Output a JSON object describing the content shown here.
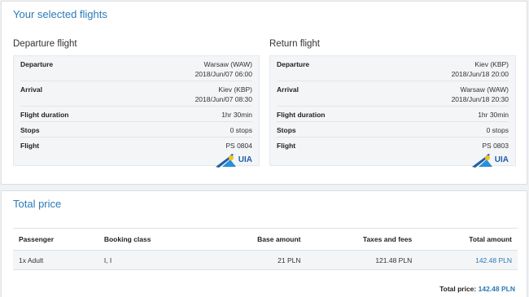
{
  "selected_flights": {
    "title": "Your selected flights",
    "departure": {
      "heading": "Departure flight",
      "rows": {
        "departure": {
          "label": "Departure",
          "line1": "Warsaw (WAW)",
          "line2": "2018/Jun/07 06:00"
        },
        "arrival": {
          "label": "Arrival",
          "line1": "Kiev (KBP)",
          "line2": "2018/Jun/07 08:30"
        },
        "duration": {
          "label": "Flight duration",
          "value": "1hr 30min"
        },
        "stops": {
          "label": "Stops",
          "value": "0 stops"
        },
        "flight": {
          "label": "Flight",
          "value": "PS 0804"
        }
      }
    },
    "return": {
      "heading": "Return flight",
      "rows": {
        "departure": {
          "label": "Departure",
          "line1": "Kiev (KBP)",
          "line2": "2018/Jun/18 20:00"
        },
        "arrival": {
          "label": "Arrival",
          "line1": "Warsaw (WAW)",
          "line2": "2018/Jun/18 20:30"
        },
        "duration": {
          "label": "Flight duration",
          "value": "1hr 30min"
        },
        "stops": {
          "label": "Stops",
          "value": "0 stops"
        },
        "flight": {
          "label": "Flight",
          "value": "PS 0803"
        }
      }
    },
    "airline_logo": {
      "icon": "uia-airline-logo",
      "text": "UIA",
      "colors": {
        "blue": "#1d5fa8",
        "yellow": "#f2c41b"
      }
    }
  },
  "total_price": {
    "title": "Total price",
    "columns": [
      "Passenger",
      "Booking class",
      "Base amount",
      "Taxes and fees",
      "Total amount"
    ],
    "rows": [
      [
        "1x Adult",
        "I, I",
        "21 PLN",
        "121.48 PLN",
        "142.48 PLN"
      ]
    ],
    "total_label": "Total price:",
    "total_value": "142.48 PLN"
  },
  "colors": {
    "accent": "#2a7ab8",
    "panel_bg": "#f3f5f7"
  }
}
